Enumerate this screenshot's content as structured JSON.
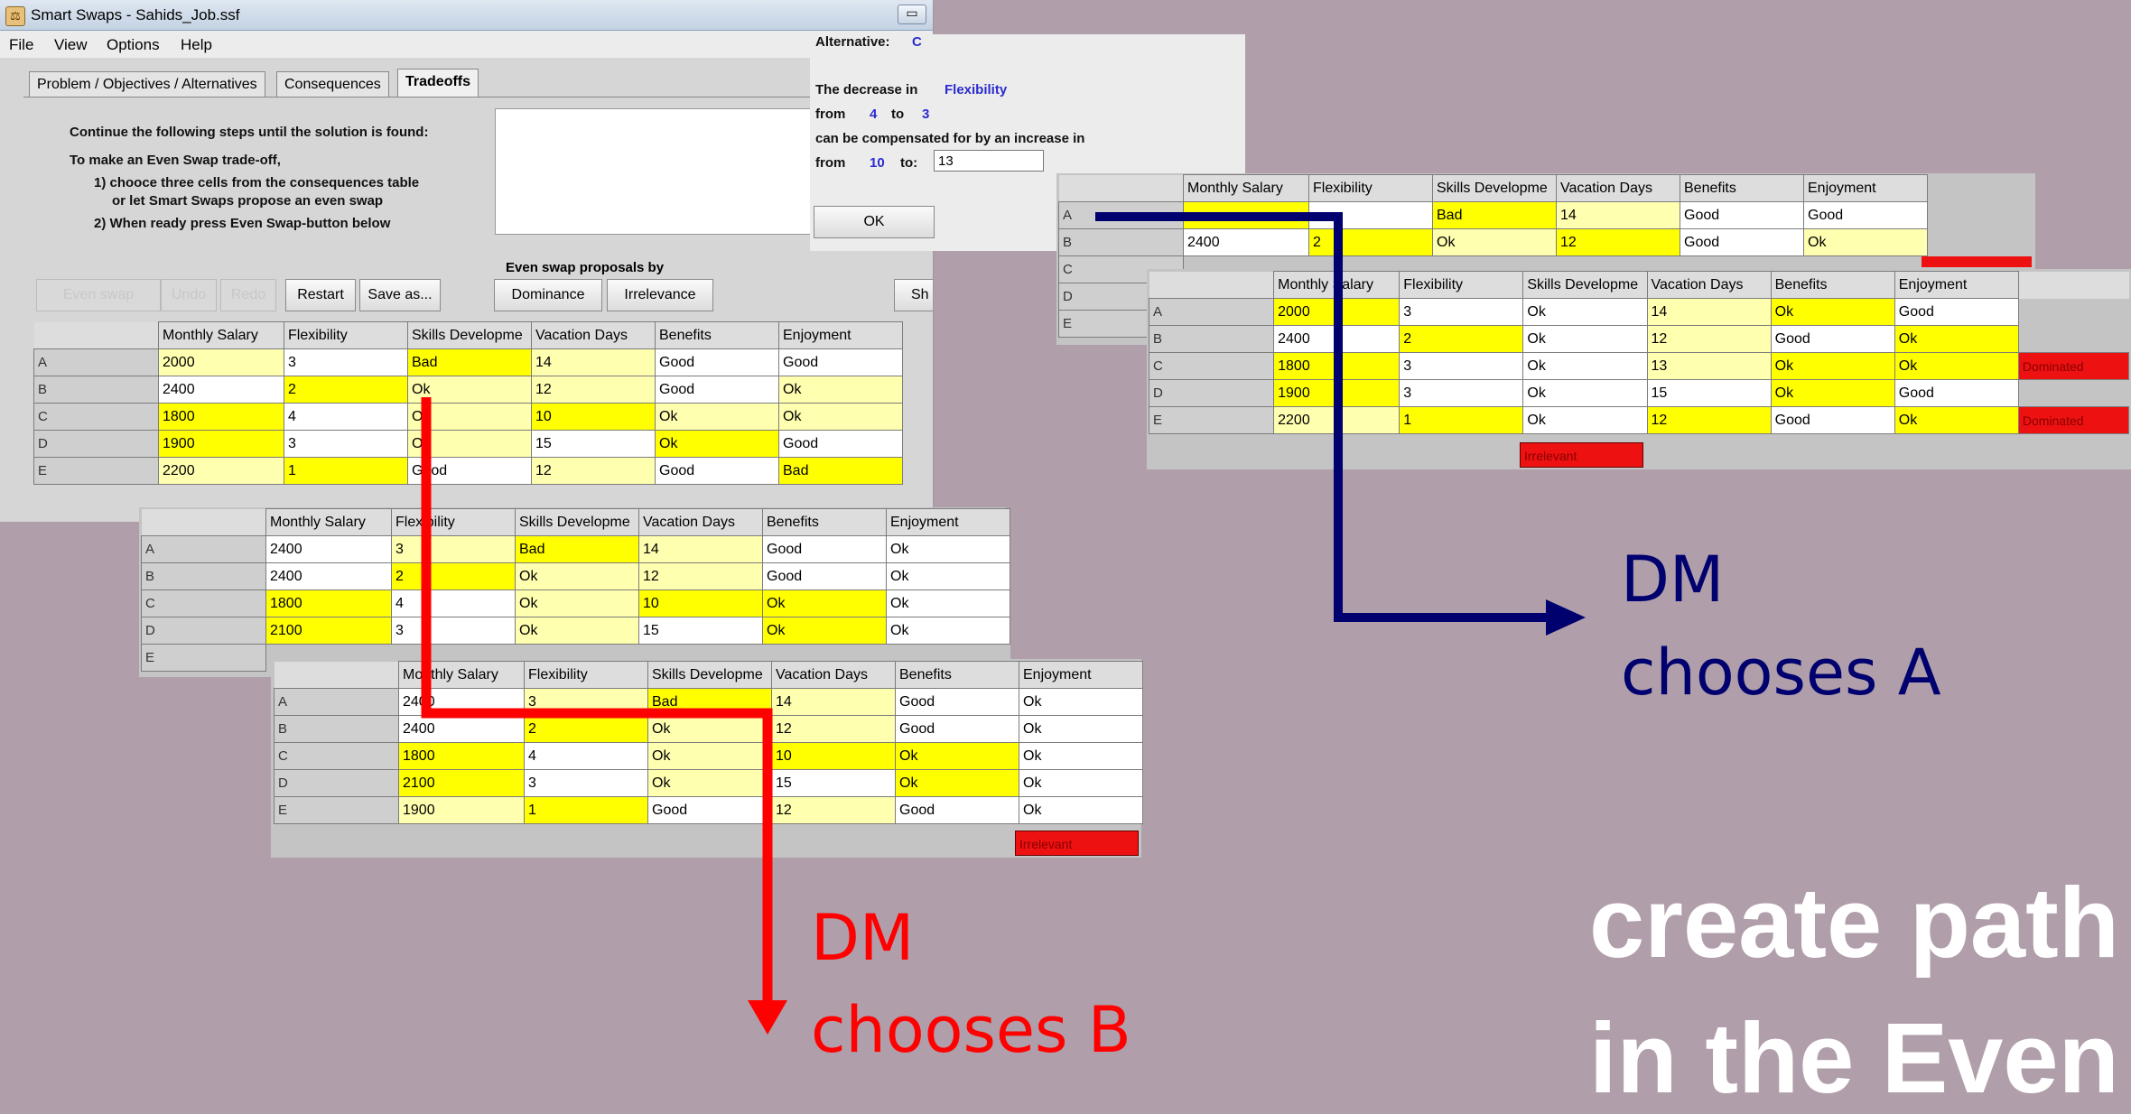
{
  "window": {
    "title": "Smart Swaps - Sahids_Job.ssf",
    "minimize_glyph": "▭",
    "app_icon_glyph": "⚖"
  },
  "menu": [
    "File",
    "View",
    "Options",
    "Help"
  ],
  "tabs": [
    "Problem / Objectives / Alternatives",
    "Consequences",
    "Tradeoffs"
  ],
  "instructions": {
    "line1": "Continue the following steps until the solution is found:",
    "line2": "To make an Even Swap trade-off,",
    "line3": "1) chooce three cells from the consequences table",
    "line4": "or let Smart Swaps propose an even swap",
    "line5": "2) When ready press Even Swap-button below"
  },
  "buttons": {
    "even_swap": "Even swap",
    "undo": "Undo",
    "redo": "Redo",
    "restart": "Restart",
    "save_as": "Save as...",
    "show": "Sh",
    "dominance": "Dominance",
    "irrelevance": "Irrelevance",
    "ok": "OK"
  },
  "proposals_label": "Even swap proposals by",
  "dialog": {
    "alternative_label": "Alternative:",
    "alternative_value": "C",
    "decrease_label": "The decrease in",
    "decrease_attr": "Flexibility",
    "from_label": "from",
    "from_value": "4",
    "to_label": "to",
    "to_value": "3",
    "comp_text": "can be compensated for by an increase in",
    "from2_label": "from",
    "from2_value": "10",
    "to2_label": "to:",
    "to2_value": "13"
  },
  "columns": [
    "Monthly Salary",
    "Flexibility",
    "Skills Developme",
    "Vacation Days",
    "Benefits",
    "Enjoyment"
  ],
  "table_main": [
    [
      "A",
      "2000",
      "3",
      "Bad",
      "14",
      "Good",
      "Good"
    ],
    [
      "B",
      "2400",
      "2",
      "Ok",
      "12",
      "Good",
      "Ok"
    ],
    [
      "C",
      "1800",
      "4",
      "Ok",
      "10",
      "Ok",
      "Ok"
    ],
    [
      "D",
      "1900",
      "3",
      "Ok",
      "15",
      "Ok",
      "Good"
    ],
    [
      "E",
      "2200",
      "1",
      "Good",
      "12",
      "Good",
      "Bad"
    ]
  ],
  "table_b1": [
    [
      "A",
      "2400",
      "3",
      "Bad",
      "14",
      "Good",
      "Ok"
    ],
    [
      "B",
      "2400",
      "2",
      "Ok",
      "12",
      "Good",
      "Ok"
    ],
    [
      "C",
      "1800",
      "4",
      "Ok",
      "10",
      "Ok",
      "Ok"
    ],
    [
      "D",
      "2100",
      "3",
      "Ok",
      "15",
      "Ok",
      "Ok"
    ],
    [
      "E",
      "",
      "",
      "",
      "",
      "",
      ""
    ]
  ],
  "table_b2": [
    [
      "A",
      "2400",
      "3",
      "Bad",
      "14",
      "Good",
      "Ok"
    ],
    [
      "B",
      "2400",
      "2",
      "Ok",
      "12",
      "Good",
      "Ok"
    ],
    [
      "C",
      "1800",
      "4",
      "Ok",
      "10",
      "Ok",
      "Ok"
    ],
    [
      "D",
      "2100",
      "3",
      "Ok",
      "15",
      "Ok",
      "Ok"
    ],
    [
      "E",
      "1900",
      "1",
      "Good",
      "12",
      "Good",
      "Ok"
    ]
  ],
  "table_a1": [
    [
      "A",
      "",
      "",
      "Bad",
      "14",
      "Good",
      "Good"
    ],
    [
      "B",
      "2400",
      "2",
      "Ok",
      "12",
      "Good",
      "Ok"
    ],
    [
      "C",
      "",
      "",
      "",
      "",
      "",
      ""
    ],
    [
      "D",
      "",
      "",
      "",
      "",
      "",
      ""
    ],
    [
      "E",
      "",
      "",
      "",
      "",
      "",
      ""
    ]
  ],
  "table_a2": [
    [
      "A",
      "2000",
      "3",
      "Ok",
      "14",
      "Ok",
      "Good",
      ""
    ],
    [
      "B",
      "2400",
      "2",
      "Ok",
      "12",
      "Good",
      "Ok",
      ""
    ],
    [
      "C",
      "1800",
      "3",
      "Ok",
      "13",
      "Ok",
      "Ok",
      "Dominated"
    ],
    [
      "D",
      "1900",
      "3",
      "Ok",
      "15",
      "Ok",
      "Good",
      ""
    ],
    [
      "E",
      "2200",
      "1",
      "Ok",
      "12",
      "Good",
      "Ok",
      "Dominated"
    ]
  ],
  "irrelevant_label": "Irrelevant",
  "annotations": {
    "dm_a_line1": "DM",
    "dm_a_line2": "chooses A",
    "dm_b_line1": "DM",
    "dm_b_line2": "chooses B",
    "headline_line1": "create path o",
    "headline_line2": "in the Even S"
  },
  "colors": {
    "background": "#b09faa",
    "path_a": "#00006e",
    "path_b": "#ff0000",
    "cell_yellow": "#ffff00",
    "cell_light_yellow": "#ffffb0",
    "dominated_red": "#ee1111"
  }
}
